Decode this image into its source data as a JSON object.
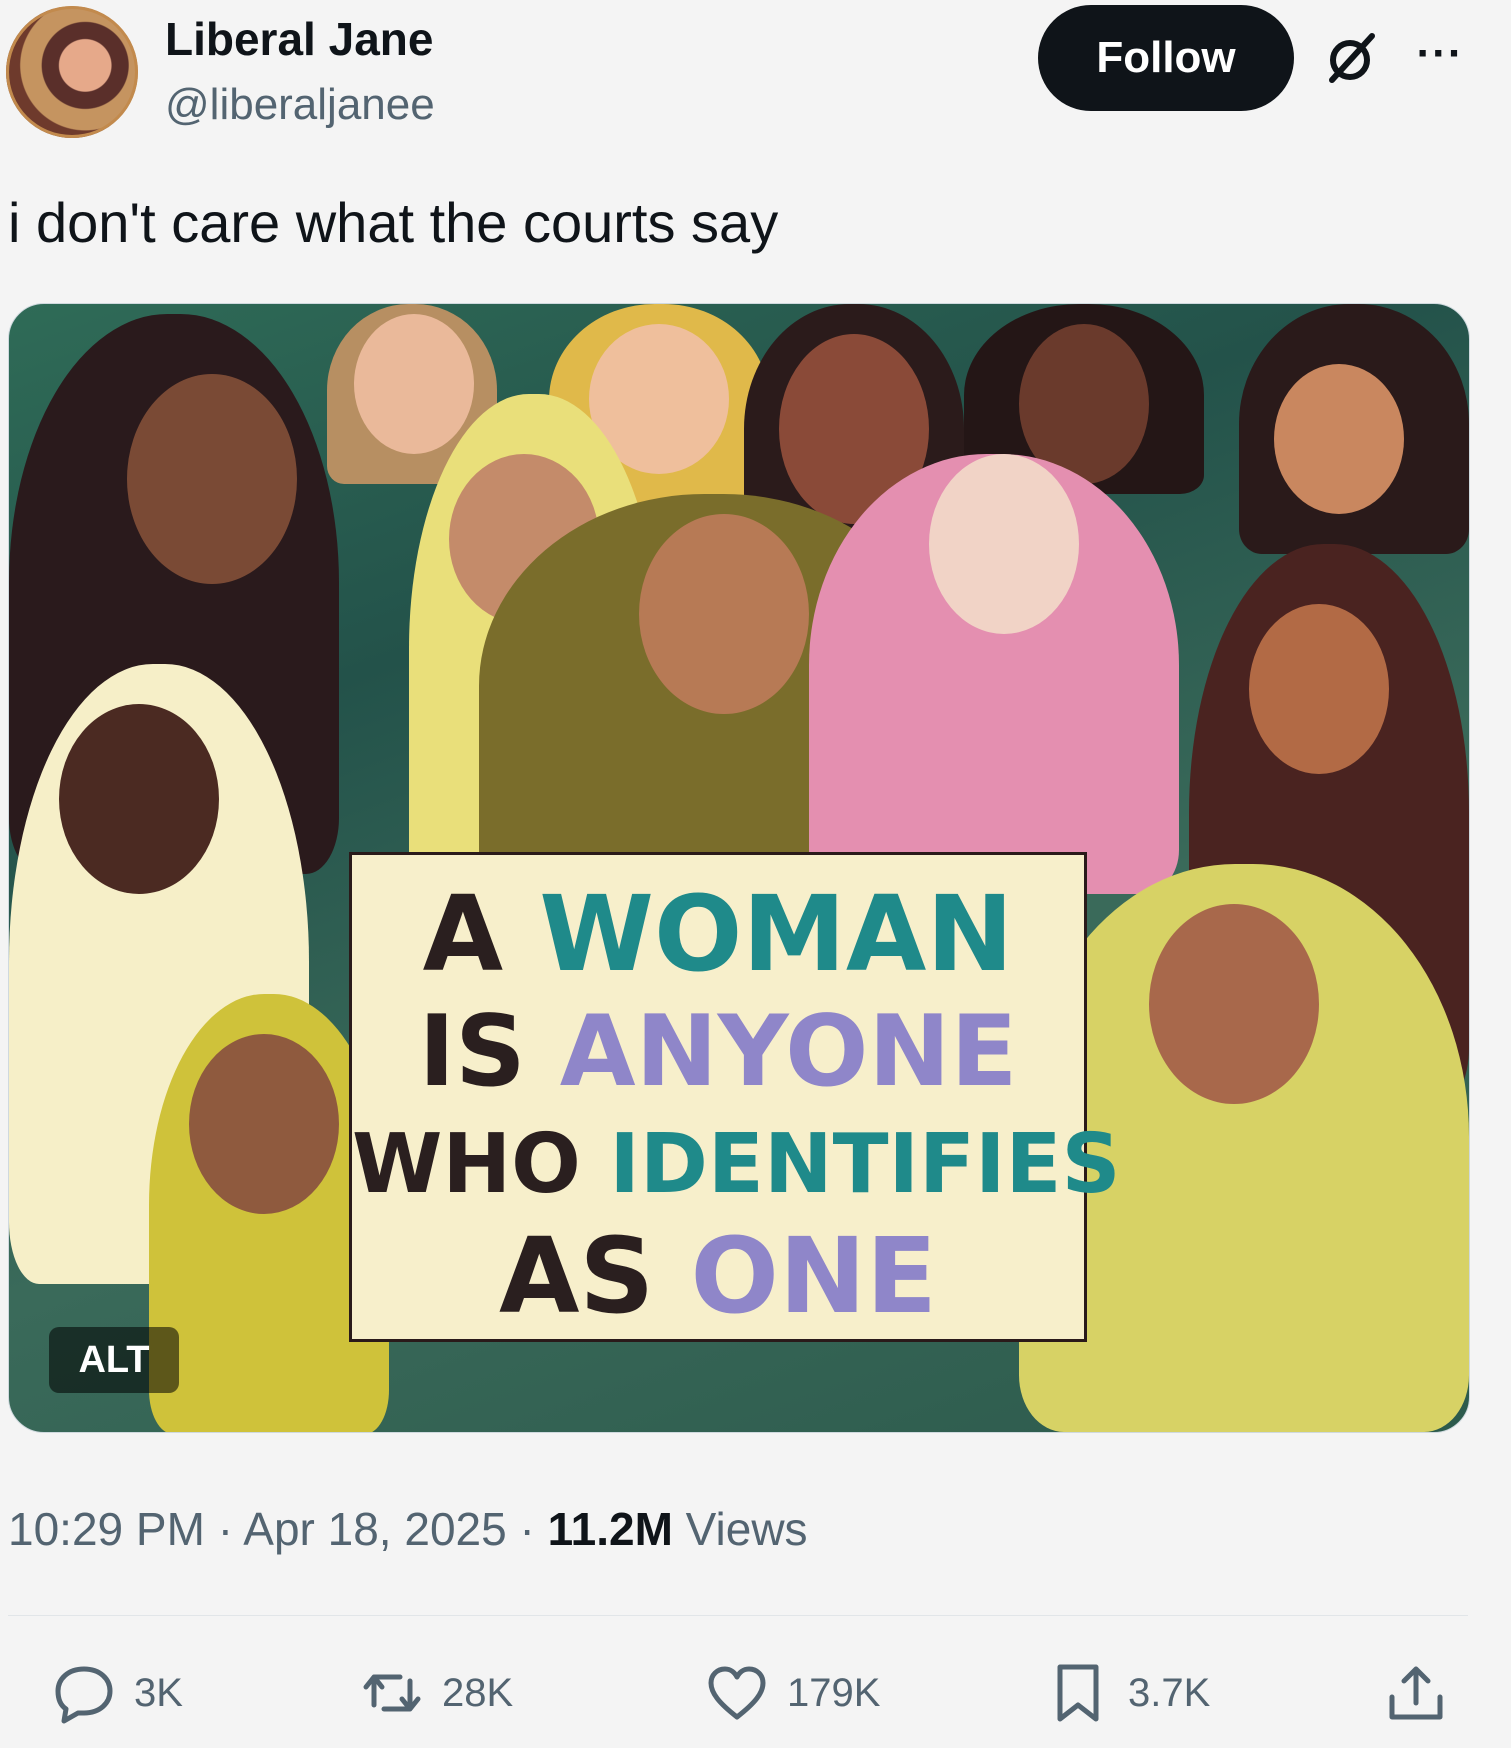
{
  "author": {
    "name": "Liberal Jane",
    "handle": "@liberaljanee"
  },
  "header": {
    "follow_label": "Follow",
    "more_label": "···"
  },
  "tweet": {
    "text": "i don't care what the courts say"
  },
  "media": {
    "sign": {
      "w_a": "A",
      "w_woman": "WOMAN",
      "w_is": "IS",
      "w_anyone": "ANYONE",
      "w_who": "WHO",
      "w_identifies": "IDENTIFIES",
      "w_as": "AS",
      "w_one": "ONE"
    },
    "alt_label": "ALT"
  },
  "meta": {
    "time": "10:29 PM",
    "sep1": "·",
    "date": "Apr 18, 2025",
    "sep2": "·",
    "views_count": "11.2M",
    "views_label": "Views"
  },
  "actions": {
    "replies": "3K",
    "reposts": "28K",
    "likes": "179K",
    "bookmarks": "3.7K"
  },
  "colors": {
    "follow_bg": "#0f1419",
    "muted_text": "#536471",
    "sign_teal": "#1f8a8a",
    "sign_lavender": "#8f86c9"
  }
}
